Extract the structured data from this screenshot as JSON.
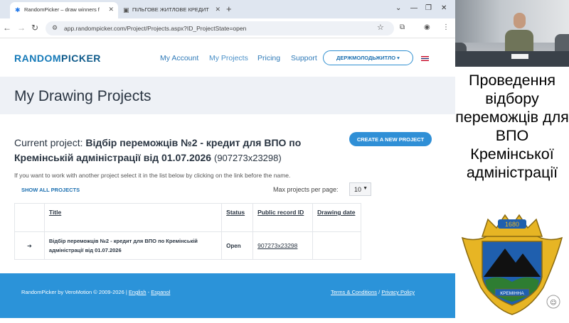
{
  "browser": {
    "tabs": [
      {
        "label": "RandomPicker – draw winners f",
        "active": true
      },
      {
        "label": "ПІЛЬГОВЕ ЖИТЛОВЕ КРЕДИТ",
        "active": false
      }
    ],
    "new_tab": "+",
    "url": "app.randompicker.com/Project/Projects.aspx?ID_ProjectState=open",
    "window_controls": [
      "⌄",
      "—",
      "❐",
      "✕"
    ]
  },
  "site": {
    "logo_part1": "RANDOM",
    "logo_part2": "PICKER",
    "nav": {
      "my_account": "My Account",
      "my_projects": "My Projects",
      "pricing": "Pricing",
      "support": "Support"
    },
    "org_button": "ДЕРЖМОЛОДЬЖИТЛО"
  },
  "page": {
    "title": "My Drawing Projects",
    "current_label": "Current project:",
    "current_name": "Відбір переможців №2 - кредит для ВПО по Кремінській адміністрації від 01.07.2026",
    "current_id": "(907273x23298)",
    "create_button": "CREATE A NEW PROJECT",
    "help_text": "If you want to work with another project select it in the list below by clicking on the link before the name.",
    "show_all": "SHOW ALL PROJECTS",
    "max_per_page_label": "Max projects per page:",
    "max_per_page_value": "10"
  },
  "table": {
    "headers": {
      "title": "Title",
      "status": "Status",
      "record_id": "Public record ID",
      "drawing_date": "Drawing date"
    },
    "rows": [
      {
        "arrow": "➔",
        "title": "Відбір переможців №2 - кредит для ВПО по Кремінській адміністрації від 01.07.2026",
        "status": "Open",
        "record_id": "907273x23298",
        "drawing_date": ""
      }
    ]
  },
  "footer": {
    "copyright": "RandomPicker by VeroMotion © 2009-2026 |",
    "lang_en": "English",
    "lang_sep": "-",
    "lang_es": "Espanol",
    "terms": "Terms & Conditions",
    "sep": "/",
    "privacy": "Privacy Policy"
  },
  "side": {
    "caption": "Проведення відбору переможців для ВПО Кремінської адміністрації",
    "emblem_year": "1680",
    "emblem_text": "КРЕМІННА"
  },
  "colors": {
    "accent": "#2b93d9",
    "brand": "#1479b8",
    "emblem_gold": "#e7b524",
    "emblem_blue": "#1f5fae",
    "emblem_green": "#2e7d32"
  }
}
